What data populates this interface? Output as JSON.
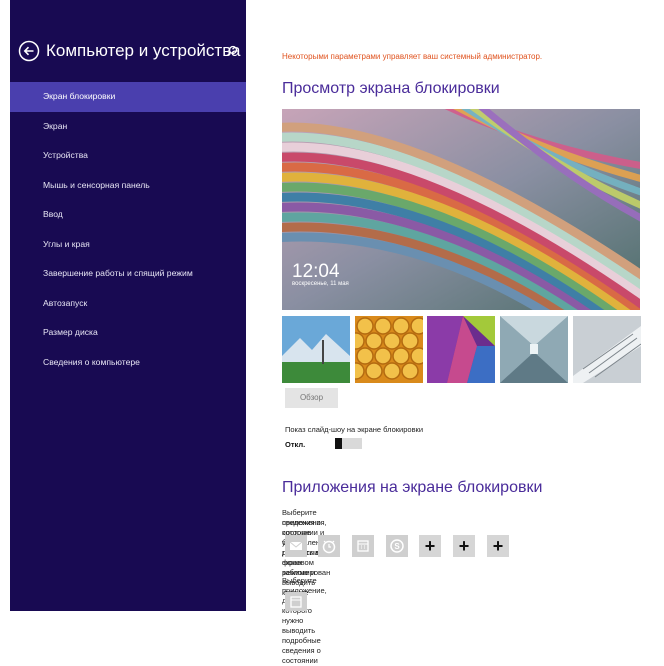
{
  "sidebar": {
    "title": "Компьютер и устройства",
    "items": [
      {
        "label": "Экран блокировки",
        "active": true
      },
      {
        "label": "Экран"
      },
      {
        "label": "Устройства"
      },
      {
        "label": "Мышь и сенсорная панель"
      },
      {
        "label": "Ввод"
      },
      {
        "label": "Углы и края"
      },
      {
        "label": "Завершение работы и спящий режим"
      },
      {
        "label": "Автозапуск"
      },
      {
        "label": "Размер диска"
      },
      {
        "label": "Сведения о компьютере"
      }
    ]
  },
  "main": {
    "admin_note": "Некоторыми параметрами управляет ваш системный администратор.",
    "preview_heading": "Просмотр экрана блокировки",
    "lock_time": "12:04",
    "lock_date": "воскресенье, 11 мая",
    "browse_label": "Обзор",
    "slideshow_label": "Показ слайд-шоу на экране блокировки",
    "slideshow_state": "Откл.",
    "apps_heading": "Приложения на экране блокировки",
    "apps_desc_1": "Выберите приложения, которые будут работать в фоновом режиме и выводить краткие",
    "apps_desc_2": "сведения о состоянии и уведомления, даже если экран заблокирован",
    "detail_desc": "Выберите приложение, для которого нужно выводить подробные сведения о состоянии",
    "app_slots": [
      "mail-icon",
      "alarm-icon",
      "calendar-icon",
      "skype-icon",
      "plus",
      "plus",
      "plus"
    ]
  },
  "colors": {
    "sidebar_bg": "#180a52",
    "sidebar_active": "#4a3fae",
    "heading": "#4a2c9a",
    "admin_note": "#e0531f"
  }
}
